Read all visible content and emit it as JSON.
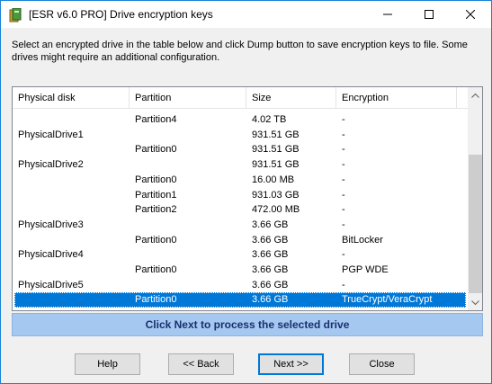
{
  "window": {
    "title": "[ESR v6.0 PRO]  Drive encryption keys",
    "controls": {
      "minimize": "minimize-icon",
      "maximize": "maximize-icon",
      "close": "close-icon"
    }
  },
  "description": "Select an encrypted drive in the table below and click Dump button to save encryption keys to file. Some drives might require an additional configuration.",
  "table": {
    "columns": [
      "Physical disk",
      "Partition",
      "Size",
      "Encryption"
    ],
    "rows": [
      {
        "disk": "",
        "partition": "Partition4",
        "size": "4.02 TB",
        "encryption": "-"
      },
      {
        "disk": "PhysicalDrive1",
        "partition": "",
        "size": "931.51 GB",
        "encryption": "-"
      },
      {
        "disk": "",
        "partition": "Partition0",
        "size": "931.51 GB",
        "encryption": "-"
      },
      {
        "disk": "PhysicalDrive2",
        "partition": "",
        "size": "931.51 GB",
        "encryption": "-"
      },
      {
        "disk": "",
        "partition": "Partition0",
        "size": "16.00 MB",
        "encryption": "-"
      },
      {
        "disk": "",
        "partition": "Partition1",
        "size": "931.03 GB",
        "encryption": "-"
      },
      {
        "disk": "",
        "partition": "Partition2",
        "size": "472.00 MB",
        "encryption": "-"
      },
      {
        "disk": "PhysicalDrive3",
        "partition": "",
        "size": "3.66 GB",
        "encryption": "-"
      },
      {
        "disk": "",
        "partition": "Partition0",
        "size": "3.66 GB",
        "encryption": "BitLocker"
      },
      {
        "disk": "PhysicalDrive4",
        "partition": "",
        "size": "3.66 GB",
        "encryption": "-"
      },
      {
        "disk": "",
        "partition": "Partition0",
        "size": "3.66 GB",
        "encryption": "PGP WDE"
      },
      {
        "disk": "PhysicalDrive5",
        "partition": "",
        "size": "3.66 GB",
        "encryption": "-"
      },
      {
        "disk": "",
        "partition": "Partition0",
        "size": "3.66 GB",
        "encryption": "TrueCrypt/VeraCrypt"
      }
    ],
    "selected_row": 12
  },
  "banner": "Click Next to process the selected drive",
  "buttons": {
    "help": "Help",
    "back": "<< Back",
    "next": "Next >>",
    "close": "Close"
  },
  "colors": {
    "selection": "#0078d7",
    "banner_bg": "#a4c8f0",
    "banner_text": "#1c2f6e",
    "window_border": "#1883d7"
  }
}
